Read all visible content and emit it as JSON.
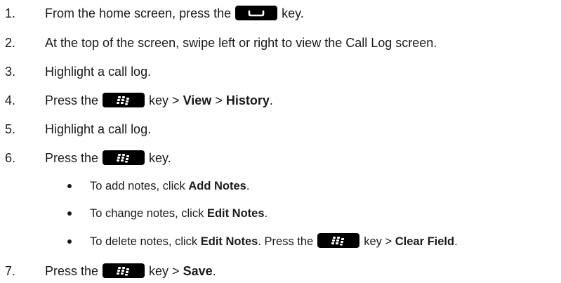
{
  "steps": [
    {
      "number": "1.",
      "pre": "From the home screen, press the",
      "key": "send-key",
      "post": "key."
    },
    {
      "number": "2.",
      "text": "At the top of the screen, swipe left or right to view the Call Log screen."
    },
    {
      "number": "3.",
      "text": "Highlight a call log."
    },
    {
      "number": "4.",
      "pre": "Press the",
      "key": "menu-key",
      "post": "key >",
      "bold1": "View",
      "mid": ">",
      "bold2": "History",
      "end": "."
    },
    {
      "number": "5.",
      "text": "Highlight a call log."
    },
    {
      "number": "6.",
      "pre": "Press the",
      "key": "menu-key",
      "post": "key."
    },
    {
      "number": "7.",
      "pre": "Press the",
      "key": "menu-key",
      "post": "key >",
      "bold1": "Save",
      "end": "."
    }
  ],
  "sub_items": [
    {
      "pre": "To add notes, click",
      "bold1": "Add Notes",
      "end": "."
    },
    {
      "pre": "To change notes, click",
      "bold1": "Edit Notes",
      "end": "."
    },
    {
      "pre": "To delete notes, click",
      "bold1": "Edit Notes",
      "mid": ". Press the",
      "key": "menu-key",
      "post": "key >",
      "bold2": "Clear Field",
      "end": "."
    }
  ],
  "icons": {
    "send_key": "send-key-icon",
    "menu_key": "blackberry-menu-key-icon"
  },
  "colors": {
    "text": "#1a1a1a",
    "key_background": "#000000",
    "key_glyph": "#ffffff"
  }
}
